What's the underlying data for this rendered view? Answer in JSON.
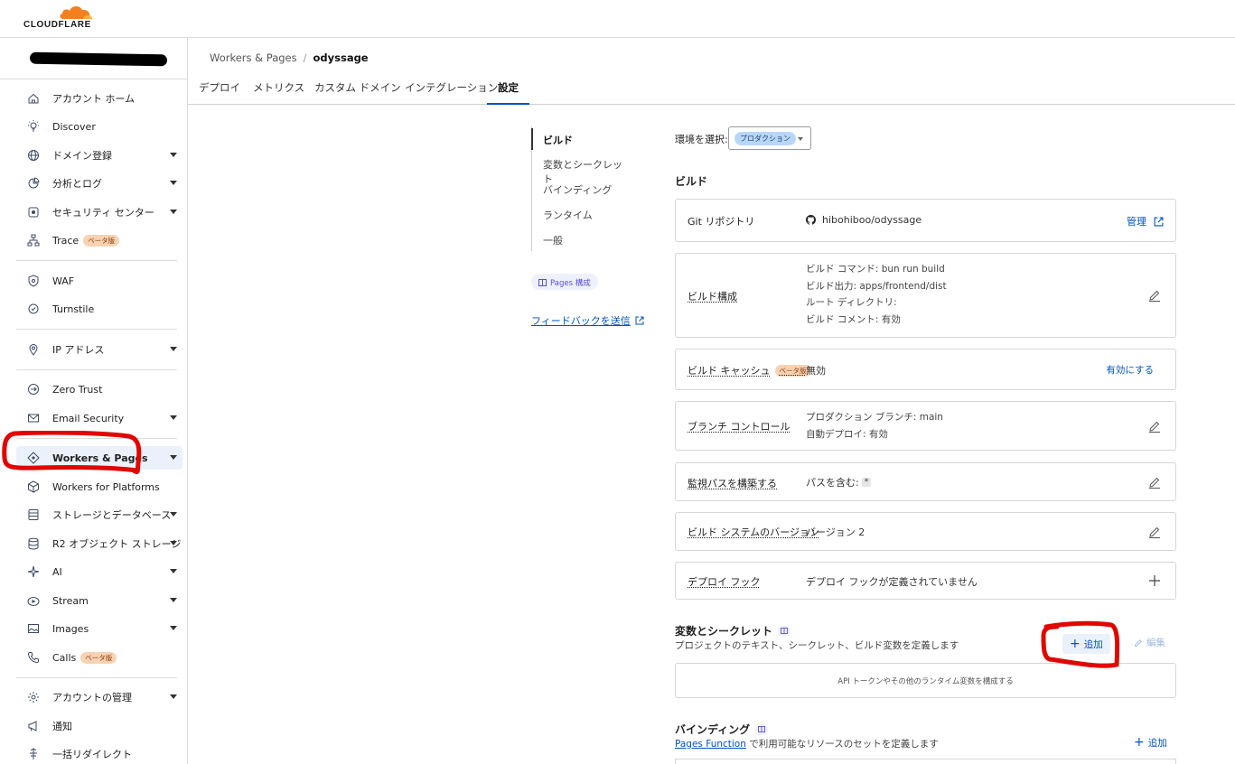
{
  "brand": {
    "name": "CLOUDFLARE",
    "accent": "#f38020"
  },
  "sidebar": {
    "items": [
      {
        "label": "アカウント ホーム",
        "icon": "home-icon",
        "caret": false
      },
      {
        "label": "Discover",
        "icon": "lightbulb-icon",
        "caret": false
      },
      {
        "label": "ドメイン登録",
        "icon": "globe-icon",
        "caret": true
      },
      {
        "label": "分析とログ",
        "icon": "pie-chart-icon",
        "caret": true
      },
      {
        "label": "セキュリティ センター",
        "icon": "security-center-icon",
        "caret": true
      },
      {
        "label": "Trace",
        "icon": "network-icon",
        "caret": false,
        "badge": "ベータ版"
      },
      {
        "label": "WAF",
        "icon": "shield-icon",
        "caret": false
      },
      {
        "label": "Turnstile",
        "icon": "turnstile-icon",
        "caret": false
      },
      {
        "label": "IP アドレス",
        "icon": "location-pin-icon",
        "caret": true
      },
      {
        "label": "Zero Trust",
        "icon": "zero-trust-icon",
        "caret": false
      },
      {
        "label": "Email Security",
        "icon": "email-icon",
        "caret": true
      },
      {
        "label": "Workers & Pages",
        "icon": "workers-icon",
        "caret": true,
        "active": true
      },
      {
        "label": "Workers for Platforms",
        "icon": "cube-icon",
        "caret": false
      },
      {
        "label": "ストレージとデータベース",
        "icon": "storage-icon",
        "caret": true
      },
      {
        "label": "R2 オブジェクト ストレージ",
        "icon": "database-icon",
        "caret": true
      },
      {
        "label": "AI",
        "icon": "sparkle-icon",
        "caret": true
      },
      {
        "label": "Stream",
        "icon": "stream-icon",
        "caret": true
      },
      {
        "label": "Images",
        "icon": "image-icon",
        "caret": true
      },
      {
        "label": "Calls",
        "icon": "phone-icon",
        "caret": false,
        "badge": "ベータ版"
      },
      {
        "label": "アカウントの管理",
        "icon": "gear-icon",
        "caret": true
      },
      {
        "label": "通知",
        "icon": "megaphone-icon",
        "caret": false
      },
      {
        "label": "一括リダイレクト",
        "icon": "redirect-icon",
        "caret": false
      }
    ]
  },
  "breadcrumb": {
    "parent": "Workers & Pages",
    "current": "odyssage"
  },
  "tabs": [
    "デプロイ",
    "メトリクス",
    "カスタム ドメイン",
    "インテグレーション",
    "設定"
  ],
  "subnav": {
    "items": [
      "ビルド",
      "変数とシークレット",
      "バインディング",
      "ランタイム",
      "一般"
    ],
    "doc_pill": "Pages 構成",
    "feedback": "フィードバックを送信"
  },
  "environment": {
    "label": "環境を選択:",
    "selected": "プロダクション"
  },
  "build": {
    "title": "ビルド",
    "git": {
      "label": "Git リポジトリ",
      "repo": "hibohiboo/odyssage",
      "action": "管理"
    },
    "config": {
      "label": "ビルド構成",
      "lines": [
        "ビルド コマンド: bun run build",
        "ビルド出力: apps/frontend/dist",
        "ルート ディレクトリ:",
        "ビルド コメント: 有効"
      ]
    },
    "cache": {
      "label": "ビルド キャッシュ",
      "badge": "ベータ版",
      "value": "無効",
      "action": "有効にする"
    },
    "branch": {
      "label": "ブランチ コントロール",
      "lines": [
        "プロダクション ブランチ: main",
        "自動デプロイ: 有効"
      ]
    },
    "watch": {
      "label": "監視パスを構築する",
      "value": "パスを含む:",
      "chip": "*"
    },
    "version": {
      "label": "ビルド システムのバージョン",
      "value": "バージョン 2"
    },
    "hook": {
      "label": "デプロイ フック",
      "value": "デプロイ フックが定義されていません"
    }
  },
  "variables": {
    "title": "変数とシークレット",
    "desc": "プロジェクトのテキスト、シークレット、ビルド変数を定義します",
    "add": "追加",
    "edit": "編集",
    "empty": "API トークンやその他のランタイム変数を構成する"
  },
  "bindings": {
    "title": "バインディング",
    "desc_link": "Pages Function",
    "desc_rest": " で利用可能なリソースのセットを定義します",
    "add": "追加"
  }
}
